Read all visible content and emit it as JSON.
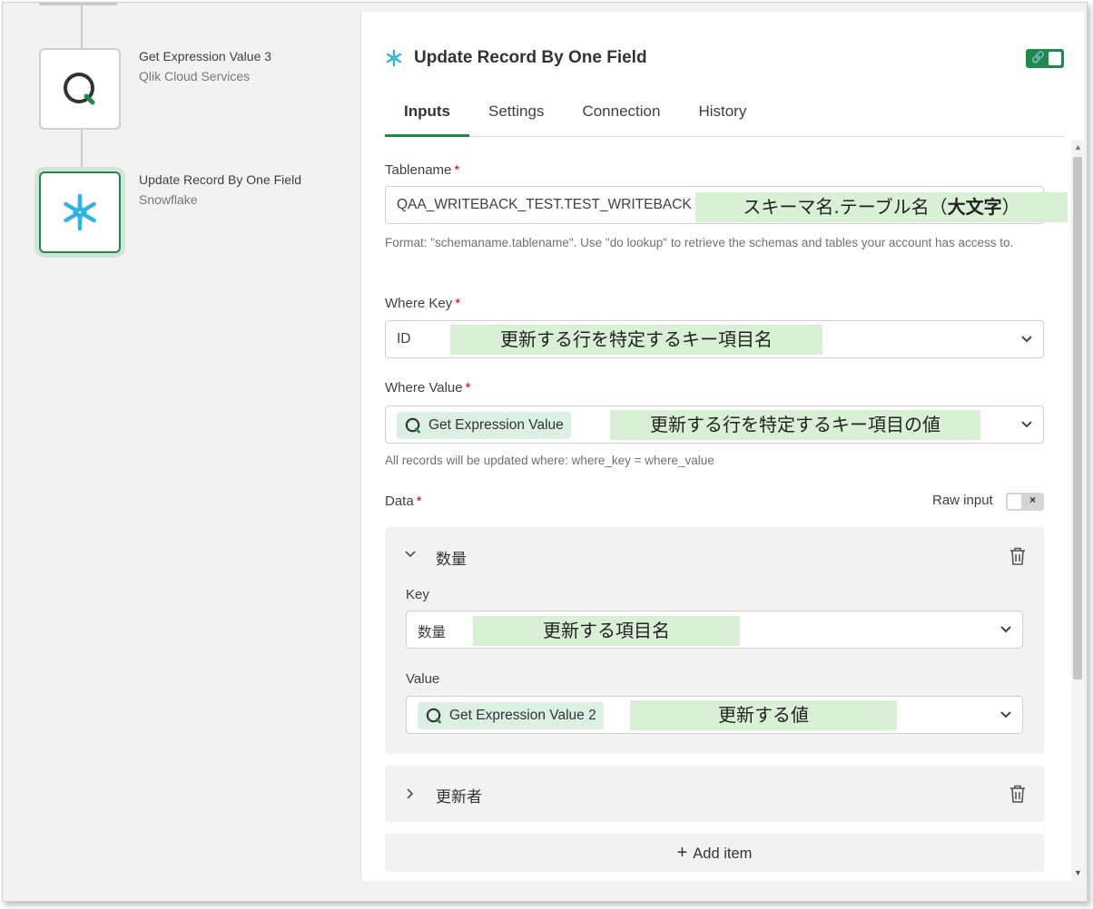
{
  "canvas": {
    "nodes": [
      {
        "title": "Get Expression Value 3",
        "subtitle": "Qlik Cloud Services",
        "icon": "qlik-icon"
      },
      {
        "title": "Update Record By One Field",
        "subtitle": "Snowflake",
        "icon": "snowflake-icon"
      }
    ]
  },
  "panel": {
    "minimize": "–",
    "title": "Update Record By One Field",
    "icon": "snowflake-icon",
    "tabs": [
      "Inputs",
      "Settings",
      "Connection",
      "History"
    ],
    "active_tab": "Inputs",
    "tablename": {
      "label": "Tablename",
      "required": "*",
      "value": "QAA_WRITEBACK_TEST.TEST_WRITEBACK",
      "help": "Format: \"schemaname.tablename\". Use \"do lookup\" to retrieve the schemas and tables your account has access to.",
      "annotation_prefix": "スキーマ名.テーブル名（",
      "annotation_bold": "大文字",
      "annotation_suffix": "）"
    },
    "where_key": {
      "label": "Where Key",
      "required": "*",
      "value": "ID",
      "annotation": "更新する行を特定するキー項目名"
    },
    "where_value": {
      "label": "Where Value",
      "required": "*",
      "chip": "Get Expression Value",
      "annotation": "更新する行を特定するキー項目の値",
      "help": "All records will be updated where: where_key = where_value"
    },
    "data": {
      "label": "Data",
      "required": "*",
      "raw_input_label": "Raw input",
      "raw_input_off": "×",
      "items": [
        {
          "name": "数量",
          "expander": "⌄",
          "key_label": "Key",
          "key_value": "数量",
          "key_annotation": "更新する項目名",
          "value_label": "Value",
          "value_chip": "Get Expression Value 2",
          "value_annotation": "更新する値"
        },
        {
          "name": "更新者",
          "expander": "›"
        }
      ],
      "add_item_plus": "+",
      "add_item_label": "Add item"
    }
  },
  "colors": {
    "accent": "#1e8a4c",
    "annotation_bg": "#d8f0d4",
    "required": "#d0021b"
  }
}
